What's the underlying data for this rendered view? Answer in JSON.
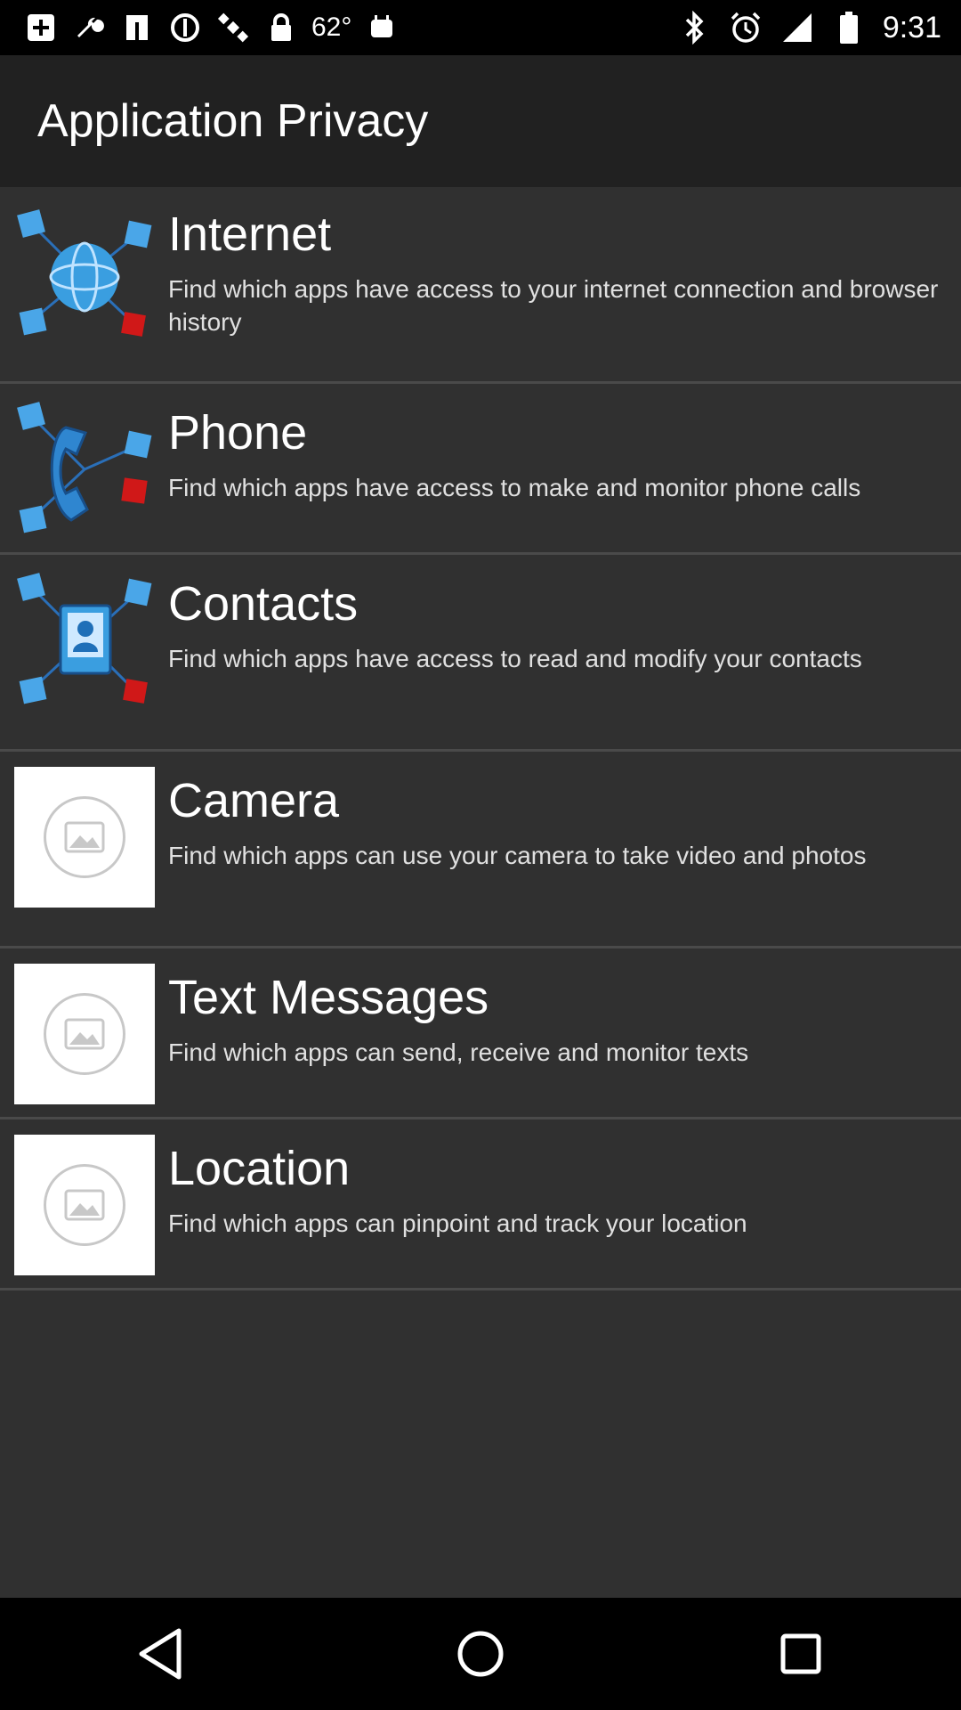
{
  "status_bar": {
    "icons_left": [
      "add-box-icon",
      "wrench-icon",
      "pause-icon",
      "block-icon",
      "satellite-icon",
      "lock-icon"
    ],
    "temperature": "62°",
    "icons_left_after": [
      "android-icon"
    ],
    "icons_right": [
      "bluetooth-icon",
      "alarm-icon",
      "signal-icon",
      "battery-icon"
    ],
    "time": "9:31"
  },
  "app_bar": {
    "title": "Application Privacy"
  },
  "items": [
    {
      "title": "Internet",
      "description": "Find which apps have access to your internet connection and browser history",
      "icon": "globe-network-icon"
    },
    {
      "title": "Phone",
      "description": "Find which apps have access to make and monitor phone calls",
      "icon": "phone-network-icon"
    },
    {
      "title": "Contacts",
      "description": "Find which apps have access to read and modify your contacts",
      "icon": "contacts-network-icon"
    },
    {
      "title": "Camera",
      "description": "Find which apps can use your camera to take video and photos",
      "icon": "image-placeholder-icon"
    },
    {
      "title": "Text Messages",
      "description": "Find which apps can send, receive and monitor texts",
      "icon": "image-placeholder-icon"
    },
    {
      "title": "Location",
      "description": "Find which apps can pinpoint and track your location",
      "icon": "image-placeholder-icon"
    }
  ],
  "nav_bar": {
    "icons": [
      "back-icon",
      "home-icon",
      "recents-icon"
    ]
  },
  "colors": {
    "app_bar": "#212121",
    "list_background": "#303030",
    "divider": "#4a4a4a",
    "node_blue": "#4aa6e8",
    "node_red": "#d01818"
  }
}
